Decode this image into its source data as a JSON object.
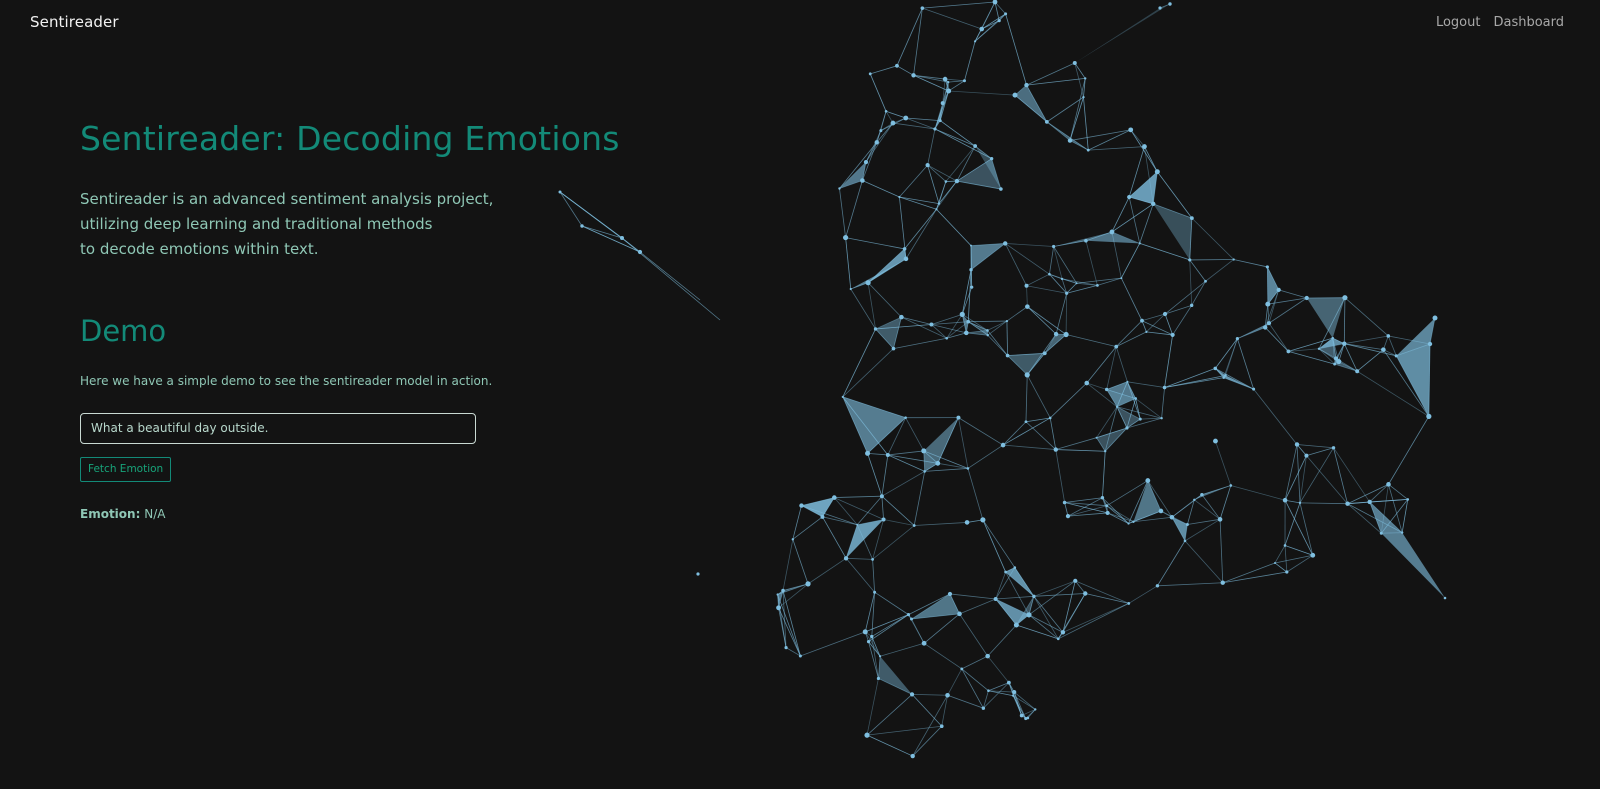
{
  "nav": {
    "brand": "Sentireader",
    "links": [
      "Logout",
      "Dashboard"
    ]
  },
  "hero": {
    "title": "Sentireader: Decoding Emotions",
    "lines": [
      "Sentireader is an advanced sentiment analysis project,",
      "utilizing deep learning and traditional methods",
      "to decode emotions within text."
    ]
  },
  "demo": {
    "title": "Demo",
    "description": "Here we have a simple demo to see the sentireader model in action.",
    "input_value": "What a beautiful day outside.",
    "button_label": "Fetch Emotion",
    "emotion_label": "Emotion:",
    "emotion_value": "N/A"
  },
  "colors": {
    "background": "#131313",
    "accent": "#138a78",
    "text": "#8fc7b5",
    "network": "#7fbfe0"
  }
}
